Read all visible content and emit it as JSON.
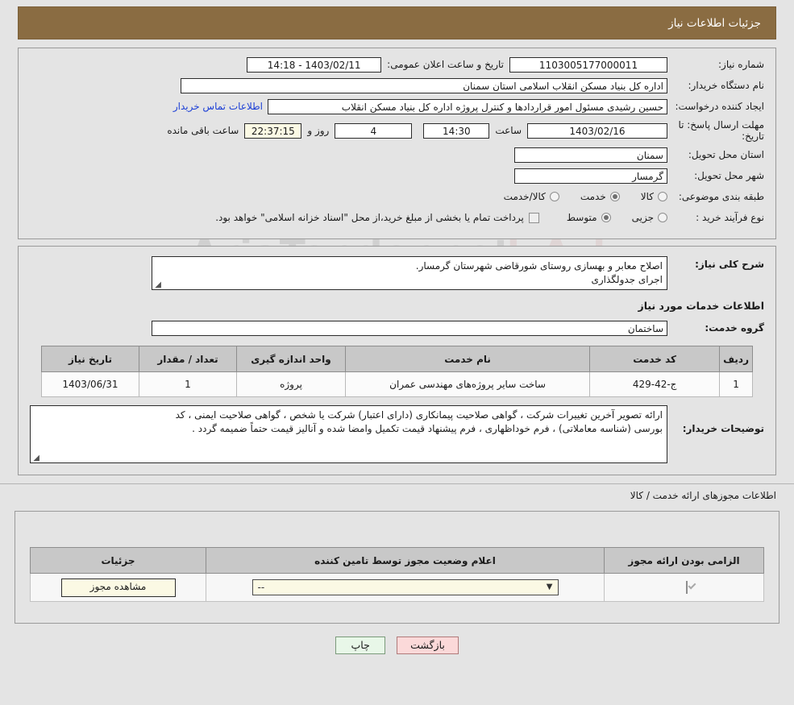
{
  "header": {
    "title": "جزئیات اطلاعات نیاز"
  },
  "form": {
    "need_number_label": "شماره نیاز:",
    "need_number_value": "1103005177000011",
    "announce_datetime_label": "تاریخ و ساعت اعلان عمومی:",
    "announce_datetime_value": "1403/02/11 - 14:18",
    "buyer_org_label": "نام دستگاه خریدار:",
    "buyer_org_value": "اداره کل بنیاد مسکن انقلاب اسلامی استان سمنان",
    "requester_label": "ایجاد کننده درخواست:",
    "requester_value": "حسین رشیدی مسئول امور قراردادها و کنترل پروژه اداره کل بنیاد مسکن انقلاب",
    "contact_link": "اطلاعات تماس خریدار",
    "deadline_label": "مهلت ارسال پاسخ: تا تاریخ:",
    "deadline_date": "1403/02/16",
    "deadline_time_label": "ساعت",
    "deadline_time": "14:30",
    "remaining_days": "4",
    "days_and_label": "روز و",
    "remaining_time": "22:37:15",
    "remaining_suffix": "ساعت باقی مانده",
    "province_label": "استان محل تحویل:",
    "province_value": "سمنان",
    "city_label": "شهر محل تحویل:",
    "city_value": "گرمسار",
    "category_label": "طبقه بندی موضوعی:",
    "category_options": [
      {
        "label": "کالا",
        "selected": false
      },
      {
        "label": "خدمت",
        "selected": true
      },
      {
        "label": "کالا/خدمت",
        "selected": false
      }
    ],
    "process_label": "نوع فرآیند خرید :",
    "process_options": [
      {
        "label": "جزیی",
        "selected": false
      },
      {
        "label": "متوسط",
        "selected": true
      }
    ],
    "treasury_checkbox_checked": false,
    "treasury_note": "پرداخت تمام یا بخشی از مبلغ خرید،از محل \"اسناد خزانه اسلامی\" خواهد بود."
  },
  "description": {
    "label": "شرح کلی نیاز:",
    "line1": "اصلاح معابر و بهسازی روستای شورقاضی شهرستان گرمسار.",
    "line2": "اجرای  جدولگذاری"
  },
  "services": {
    "section_title": "اطلاعات خدمات مورد نیاز",
    "group_label": "گروه خدمت:",
    "group_value": "ساختمان",
    "columns": [
      "ردیف",
      "کد خدمت",
      "نام خدمت",
      "واحد اندازه گیری",
      "تعداد / مقدار",
      "تاریخ نیاز"
    ],
    "rows": [
      {
        "index": "1",
        "code": "ج-42-429",
        "name": "ساخت سایر پروژه‌های مهندسی عمران",
        "unit": "پروژه",
        "quantity": "1",
        "need_date": "1403/06/31"
      }
    ]
  },
  "buyer_notes": {
    "label": "توضیحات خریدار:",
    "line1": "ارائه تصویر آخرین تغییرات شرکت ، گواهی صلاحیت پیمانکاری (دارای اعتبار) شرکت یا شخص ، گواهی صلاحیت ایمنی ، کد",
    "line2": "بورسی (شناسه معاملاتی) ، فرم خوداظهاری ، فرم پیشنهاد قیمت تکمیل وامضا شده و آنالیز قیمت حتماً ضمیمه گردد ."
  },
  "permits": {
    "section_label": "اطلاعات مجوزهای ارائه خدمت / کالا",
    "columns": [
      "الزامی بودن ارائه مجوز",
      "اعلام وضعیت مجوز توسط تامین کننده",
      "جزئیات"
    ],
    "rows": [
      {
        "required_checked": true,
        "status_value": "--",
        "details_button": "مشاهده مجوز"
      }
    ]
  },
  "footer": {
    "print_label": "چاپ",
    "back_label": "بازگشت"
  },
  "watermark": {
    "text": "AriaTender.net"
  }
}
